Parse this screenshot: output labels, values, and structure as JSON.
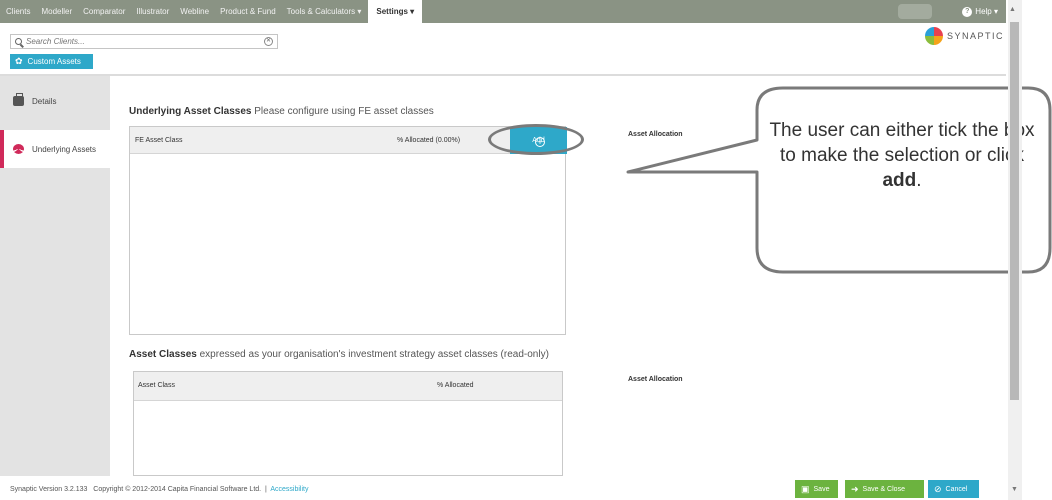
{
  "nav": {
    "items": [
      "Clients",
      "Modeller",
      "Comparator",
      "Illustrator",
      "Webline",
      "Product & Fund",
      "Tools & Calculators ▾"
    ],
    "active": "Settings ▾",
    "help": "Help ▾"
  },
  "search": {
    "placeholder": "Search Clients..."
  },
  "custom_assets": "Custom Assets",
  "logo": "SYNAPTIC",
  "sidebar": {
    "items": [
      {
        "label": "Details",
        "icon": "briefcase-icon"
      },
      {
        "label": "Underlying Assets",
        "icon": "pie-chart-icon"
      }
    ]
  },
  "section1": {
    "title": "Underlying Asset Classes",
    "subtitle": "Please configure using FE asset classes",
    "col1": "FE Asset Class",
    "col2": "% Allocated (0.00%)",
    "add": "Add",
    "allocation_label": "Asset Allocation"
  },
  "section2": {
    "title": "Asset Classes",
    "subtitle": "expressed as your organisation's investment strategy asset classes (read-only)",
    "col1": "Asset Class",
    "col2": "% Allocated",
    "allocation_label": "Asset Allocation"
  },
  "callout": {
    "text_before": "The user can either tick the box to make the selection or click",
    "bold": "add",
    "text_after": "."
  },
  "footer": {
    "version": "Synaptic Version 3.2.133",
    "copyright": "Copyright © 2012-2014 Capita Financial Software Ltd.",
    "separator": "|",
    "accessibility": "Accessibility"
  },
  "buttons": {
    "save": "Save",
    "save_close": "Save & Close",
    "cancel": "Cancel"
  },
  "colors": {
    "accent": "#2ea8c9",
    "nav": "#8a9384",
    "active_sidebar": "#d02a5a",
    "save_green": "#6cb33f"
  }
}
